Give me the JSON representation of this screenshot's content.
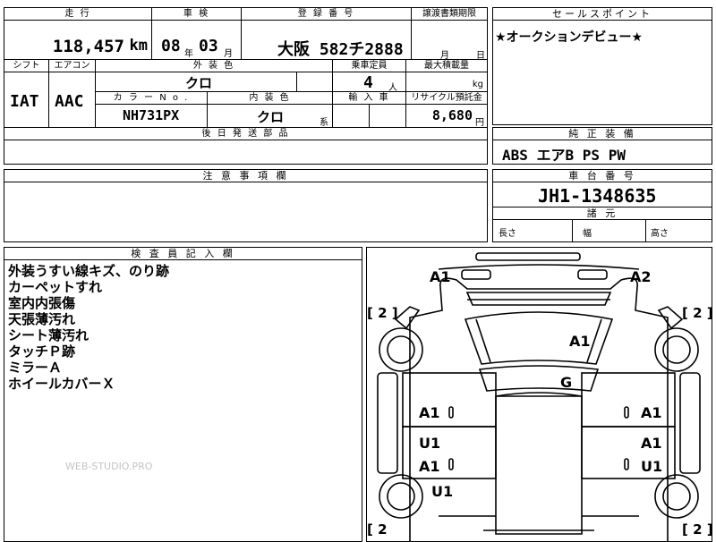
{
  "top": {
    "mileage_label": "走 行",
    "mileage_value": "118,457",
    "mileage_unit": "km",
    "inspect_label": "車 検",
    "inspect_year": "08",
    "inspect_year_unit": "年",
    "inspect_month": "03",
    "inspect_month_unit": "月",
    "reg_label": "登 録 番 号",
    "reg_value": "大阪 582チ2888",
    "transfer_label": "譲渡書類期限",
    "transfer_month_unit": "月",
    "transfer_day_unit": "日",
    "sales_label": "セールスポイント",
    "sales_text": "★オークションデビュー★"
  },
  "row2": {
    "shift_label": "シフト",
    "ac_label": "エアコン",
    "color_label": "外 装 色",
    "capacity_label": "乗車定員",
    "load_label": "最大積載量",
    "shift_value": "IAT",
    "ac_value": "AAC",
    "color_value": "クロ",
    "capacity_value": "4",
    "capacity_unit": "人",
    "load_unit": "kg",
    "color_no_label": "カ ラ ー N o .",
    "interior_label": "内 装 色",
    "import_label": "輸 入 車",
    "recycle_label": "リサイクル預託金",
    "color_no_value": "NH731PX",
    "interior_value": "クロ",
    "interior_unit": "系",
    "recycle_value": "8,680",
    "recycle_unit": "円",
    "later_label": "後 日 発 送 部 品"
  },
  "equip": {
    "label": "純 正 装 備",
    "value": "ABS エアB PS PW"
  },
  "caution": {
    "label": "注 意 事 項 欄"
  },
  "chassis": {
    "label": "車 台 番 号",
    "value": "JH1-1348635",
    "dims_label": "諸 元",
    "length_label": "長さ",
    "width_label": "幅",
    "height_label": "高さ"
  },
  "inspector": {
    "label": "検 査 員 記 入 欄",
    "notes": [
      "外装うすい線キズ、のり跡",
      "カーペットすれ",
      "室内内張傷",
      "天張薄汚れ",
      "シート薄汚れ",
      "タッチＰ跡",
      "ミラーＡ",
      "ホイールカバーＸ"
    ],
    "watermark": "WEB-STUDIO.PRO"
  },
  "diagram": {
    "marks": [
      "A1",
      "A2",
      "A1",
      "G",
      "A1",
      "A1",
      "U1",
      "A1",
      "A1",
      "U1",
      "U1"
    ],
    "tire_labels": [
      "[ 2 ]",
      "[ 2 ]",
      "[ 2",
      "[ 2 ]"
    ]
  }
}
